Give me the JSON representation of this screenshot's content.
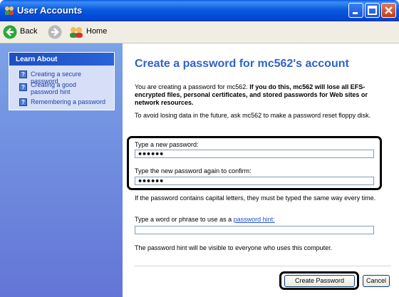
{
  "window": {
    "title": "User Accounts"
  },
  "toolbar": {
    "back_label": "Back",
    "home_label": "Home"
  },
  "sidebar": {
    "heading": "Learn About",
    "items": [
      {
        "label": "Creating a secure password"
      },
      {
        "label": "Creating a good password hint"
      },
      {
        "label": "Remembering a password"
      }
    ]
  },
  "main": {
    "heading": "Create a password for mc562's account",
    "intro_normal": "You are creating a password for mc562. ",
    "intro_bold": "If you do this, mc562 will lose all EFS-encrypted files, personal certificates, and stored passwords for Web sites or network resources.",
    "reset_text": "To avoid losing data in the future, ask mc562 to make a password reset floppy disk.",
    "new_password_label": "Type a new password:",
    "new_password_value": "••••••",
    "confirm_label": "Type the new password again to confirm:",
    "confirm_value": "••••••",
    "case_note": "If the password contains capital letters, they must be typed the same way every time.",
    "hint_label_prefix": "Type a word or phrase to use as a ",
    "hint_link": "password hint:",
    "hint_value": "",
    "hint_note": "The password hint will be visible to everyone who uses this computer.",
    "create_button": "Create Password",
    "cancel_button": "Cancel"
  },
  "colors": {
    "titlebar": "#0a5ae0",
    "heading": "#2f63c8",
    "sidebar": "#7ba2e7",
    "link": "#2251c6"
  }
}
